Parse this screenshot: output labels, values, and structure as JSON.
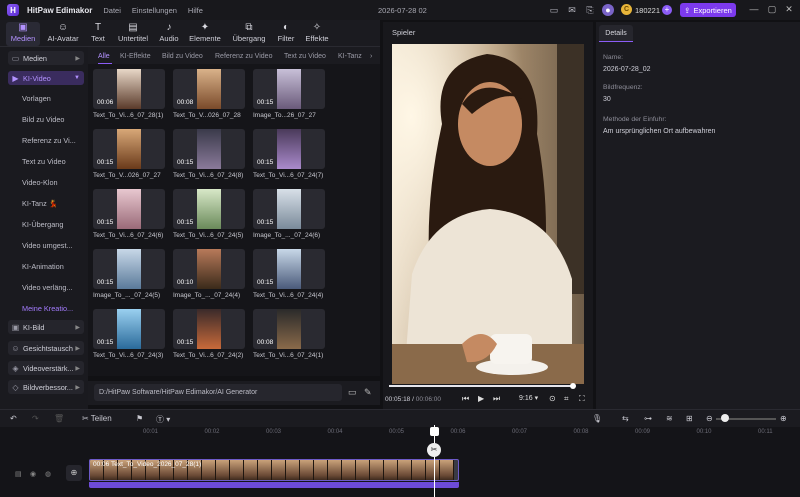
{
  "titlebar": {
    "app_name": "HitPaw Edimakor",
    "menus": [
      "Datei",
      "Einstellungen",
      "Hilfe"
    ],
    "project_date": "2026-07-28 02",
    "credits": "180221",
    "export_label": "Exportieren"
  },
  "toolbar": {
    "tools": [
      {
        "label": "Medien",
        "icon": "media-icon"
      },
      {
        "label": "AI-Avatar",
        "icon": "avatar-icon"
      },
      {
        "label": "Text",
        "icon": "text-icon"
      },
      {
        "label": "Untertitel",
        "icon": "subtitle-icon"
      },
      {
        "label": "Audio",
        "icon": "audio-icon"
      },
      {
        "label": "Elemente",
        "icon": "elements-icon"
      },
      {
        "label": "Übergang",
        "icon": "transition-icon"
      },
      {
        "label": "Filter",
        "icon": "filter-icon"
      },
      {
        "label": "Effekte",
        "icon": "effects-icon"
      }
    ]
  },
  "sidebar": {
    "medien": "Medien",
    "ki_video": "KI-Video",
    "sub_items": [
      "Vorlagen",
      "Bild zu Video",
      "Referenz zu Vi...",
      "Text zu Video",
      "Video-Klon",
      "KI-Tanz 💃",
      "KI-Übergang",
      "Video umgest...",
      "KI-Animation",
      "Video verläng...",
      "Meine Kreatio..."
    ],
    "bottom": [
      "KI-Bild",
      "Gesichtstausch",
      "Videoverstärk...",
      "Bildverbessor..."
    ]
  },
  "categories": [
    "Alle",
    "KI-Effekte",
    "Bild zu Video",
    "Referenz zu Video",
    "Text zu Video",
    "KI-Tanz"
  ],
  "media_items": [
    {
      "dur": "00:06",
      "cap": "Text_To_Vi...6_07_28(1)"
    },
    {
      "dur": "00:08",
      "cap": "Text_To_V...026_07_28"
    },
    {
      "dur": "00:15",
      "cap": "Image_To...26_07_27"
    },
    {
      "dur": "00:15",
      "cap": "Text_To_V...026_07_27"
    },
    {
      "dur": "00:15",
      "cap": "Text_To_Vi...6_07_24(8)"
    },
    {
      "dur": "00:15",
      "cap": "Text_To_Vi...6_07_24(7)"
    },
    {
      "dur": "00:15",
      "cap": "Text_To_Vi...6_07_24(6)"
    },
    {
      "dur": "00:15",
      "cap": "Text_To_Vi...6_07_24(5)"
    },
    {
      "dur": "00:15",
      "cap": "Image_To_..._07_24(6)"
    },
    {
      "dur": "00:15",
      "cap": "Image_To_..._07_24(5)"
    },
    {
      "dur": "00:10",
      "cap": "Image_To_..._07_24(4)"
    },
    {
      "dur": "00:15",
      "cap": "Text_To_Vi...6_07_24(4)"
    },
    {
      "dur": "00:15",
      "cap": "Text_To_Vi...6_07_24(3)"
    },
    {
      "dur": "00:15",
      "cap": "Text_To_Vi...6_07_24(2)"
    },
    {
      "dur": "00:08",
      "cap": "Text_To_Vi...6_07_24(1)"
    }
  ],
  "path": "D:/HitPaw Software/HitPaw Edimakor/AI Generator",
  "player": {
    "title": "Spieler",
    "current": "00:05:18",
    "total": "00:06:00",
    "ratio": "9:16",
    "progress": 0.99
  },
  "details": {
    "tab": "Details",
    "name_label": "Name:",
    "name_value": "2026-07-28_02",
    "fps_label": "Bildfrequenz:",
    "fps_value": "30",
    "method_label": "Methode der Einfuhr:",
    "method_value": "Am ursprünglichen Ort aufbewahren"
  },
  "timeline": {
    "split_label": "Teilen",
    "ticks": [
      "00:01",
      "00:02",
      "00:03",
      "00:04",
      "00:05",
      "00:06",
      "00:07",
      "00:08",
      "00:09",
      "00:10",
      "00:11"
    ],
    "clip_label": "00:06 Text_To_Video_2026_07_28(1)"
  }
}
